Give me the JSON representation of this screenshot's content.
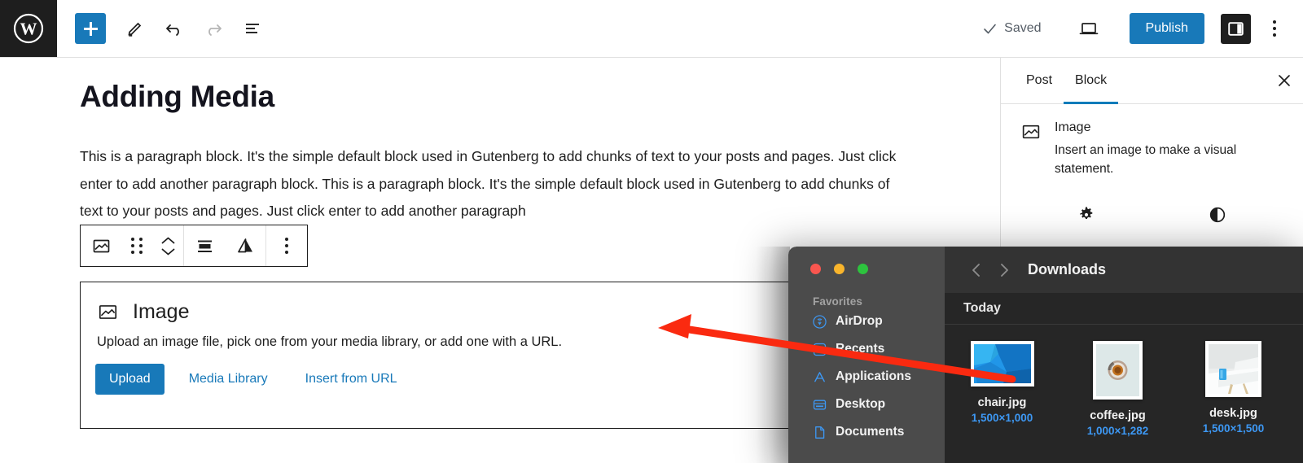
{
  "app": {
    "name": "WordPress Block Editor",
    "logo_icon": "wordpress-logo-icon"
  },
  "header": {
    "inserter_icon": "plus-icon",
    "edit_icon": "pencil-icon",
    "undo_icon": "undo-arrow-icon",
    "redo_icon": "redo-arrow-icon",
    "list_view_icon": "list-view-icon",
    "saved_label": "Saved",
    "saved_check_icon": "checkmark-icon",
    "preview_icon": "laptop-preview-icon",
    "publish_label": "Publish",
    "sidebar_toggle_icon": "sidebar-panel-icon",
    "options_icon": "vertical-ellipsis-icon"
  },
  "editor": {
    "post_title": "Adding Media",
    "paragraph": "This is a paragraph block. It's the simple default block used in Gutenberg to add chunks of text to your posts and pages. Just click enter to add another paragraph block. This is a paragraph block. It's the simple default block used in Gutenberg to add chunks of text to your posts and pages. Just click enter to add another paragraph",
    "block_toolbar": {
      "block_type_icon": "image-block-icon",
      "drag_handle_icon": "drag-handle-icon",
      "move_up_icon": "chevron-up-icon",
      "move_down_icon": "chevron-down-icon",
      "align_icon": "align-block-icon",
      "justify_icon": "change-alignment-icon",
      "more_options_icon": "vertical-ellipsis-icon"
    },
    "image_block": {
      "icon": "image-block-icon",
      "title": "Image",
      "description": "Upload an image file, pick one from your media library, or add one with a URL.",
      "upload_label": "Upload",
      "media_library_label": "Media Library",
      "insert_url_label": "Insert from URL"
    }
  },
  "settings_sidebar": {
    "tabs": [
      {
        "label": "Post",
        "active": false
      },
      {
        "label": "Block",
        "active": true
      }
    ],
    "close_icon": "close-x-icon",
    "block_icon": "image-block-icon",
    "block_name": "Image",
    "block_description": "Insert an image to make a visual statement.",
    "icon_tabs": [
      {
        "name": "settings-gear-icon"
      },
      {
        "name": "styles-contrast-icon"
      }
    ]
  },
  "finder": {
    "traffic_lights": [
      "close-red-button",
      "minimize-yellow-button",
      "maximize-green-button"
    ],
    "back_icon": "chevron-left-icon",
    "forward_icon": "chevron-right-icon",
    "title": "Downloads",
    "group_header": "Today",
    "sidebar": {
      "section_label": "Favorites",
      "items": [
        {
          "label": "AirDrop",
          "icon": "airdrop-icon"
        },
        {
          "label": "Recents",
          "icon": "recents-clock-icon"
        },
        {
          "label": "Applications",
          "icon": "applications-icon"
        },
        {
          "label": "Desktop",
          "icon": "desktop-icon"
        },
        {
          "label": "Documents",
          "icon": "documents-icon"
        }
      ]
    },
    "files": [
      {
        "name": "chair.jpg",
        "dimensions": "1,500×1,000",
        "thumb": "blue-chair-photo"
      },
      {
        "name": "coffee.jpg",
        "dimensions": "1,000×1,282",
        "thumb": "coffee-cup-photo"
      },
      {
        "name": "desk.jpg",
        "dimensions": "1,500×1,500",
        "thumb": "white-desk-photo"
      }
    ]
  },
  "annotation": {
    "arrow_color": "#fa2a10",
    "arrow_description": "red arrow pointing from chair.jpg thumbnail toward the editor canvas"
  },
  "colors": {
    "accent_blue": "#1879b9",
    "tab_underline": "#007cba",
    "link_blue": "#1879b9",
    "finder_sidebar": "#4b4b4b",
    "finder_toolbar": "#333333",
    "finder_content": "#262626",
    "file_dim_blue": "#3d98f4"
  }
}
